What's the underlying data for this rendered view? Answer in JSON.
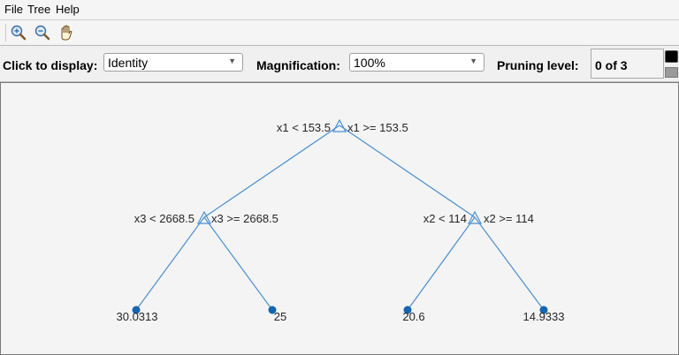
{
  "menu": {
    "items": [
      "File",
      "Tree",
      "Help"
    ]
  },
  "toolbar": {
    "tools": [
      "zoom-in-icon",
      "zoom-out-icon",
      "pan-hand-icon"
    ]
  },
  "controls": {
    "click_label": "Click to display:",
    "click_value": "Identity",
    "magnification_label": "Magnification:",
    "magnification_value": "100%",
    "pruning_label": "Pruning level:",
    "pruning_value": "0 of 3"
  },
  "tree": {
    "root": {
      "left_label": "x1 < 153.5",
      "right_label": "x1 >= 153.5"
    },
    "left": {
      "left_label": "x3 < 2668.5",
      "right_label": "x3 >= 2668.5"
    },
    "right": {
      "left_label": "x2 < 114",
      "right_label": "x2 >= 114"
    },
    "leaves": [
      "30.0313",
      "25",
      "20.6",
      "14.9333"
    ],
    "colors": {
      "branch": "#4a8fd0",
      "leaf": "#1565b0",
      "text": "#262626"
    }
  }
}
